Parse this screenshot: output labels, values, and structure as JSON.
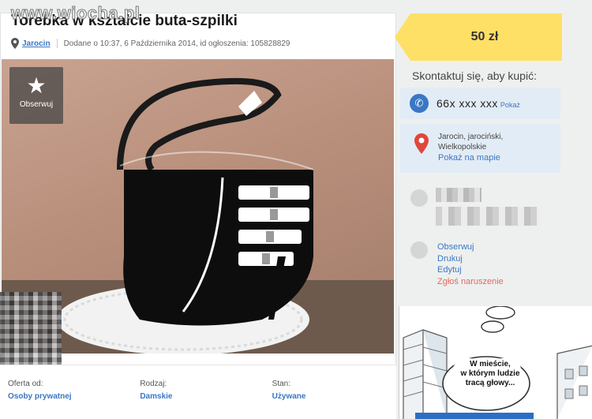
{
  "watermark": "www.wiocha.pl",
  "listing": {
    "title": "Torebka w kształcie buta-szpilki",
    "city": "Jarocin",
    "added": "Dodane o 10:37, 6 Października 2014, id ogłoszenia: 105828829",
    "follow_label": "Obserwuj",
    "icons": {
      "pin": "location-pin-icon",
      "star": "star-icon"
    }
  },
  "details": [
    {
      "label": "Oferta od:",
      "value": "Osoby prywatnej"
    },
    {
      "label": "Rodzaj:",
      "value": "Damskie"
    },
    {
      "label": "Stan:",
      "value": "Używane"
    }
  ],
  "price": "50 zł",
  "contact": {
    "heading": "Skontaktuj się, aby kupić:",
    "phone": "66x xxx xxx",
    "show_label": "Pokaż",
    "location_line1": "Jarocin, jarociński,",
    "location_line2": "Wielkopolskie",
    "map_link": "Pokaż na mapie"
  },
  "actions": {
    "follow": "Obserwuj",
    "print": "Drukuj",
    "edit": "Edytuj",
    "report": "Zgłoś naruszenie"
  },
  "comic": {
    "line1": "W mieście,",
    "line2": "w którym ludzie",
    "line3": "tracą głowy..."
  },
  "colors": {
    "accent": "#3a77c4",
    "price_bg": "#ffe066",
    "panel_bg": "#e2ecf6",
    "report": "#e36a5a"
  }
}
